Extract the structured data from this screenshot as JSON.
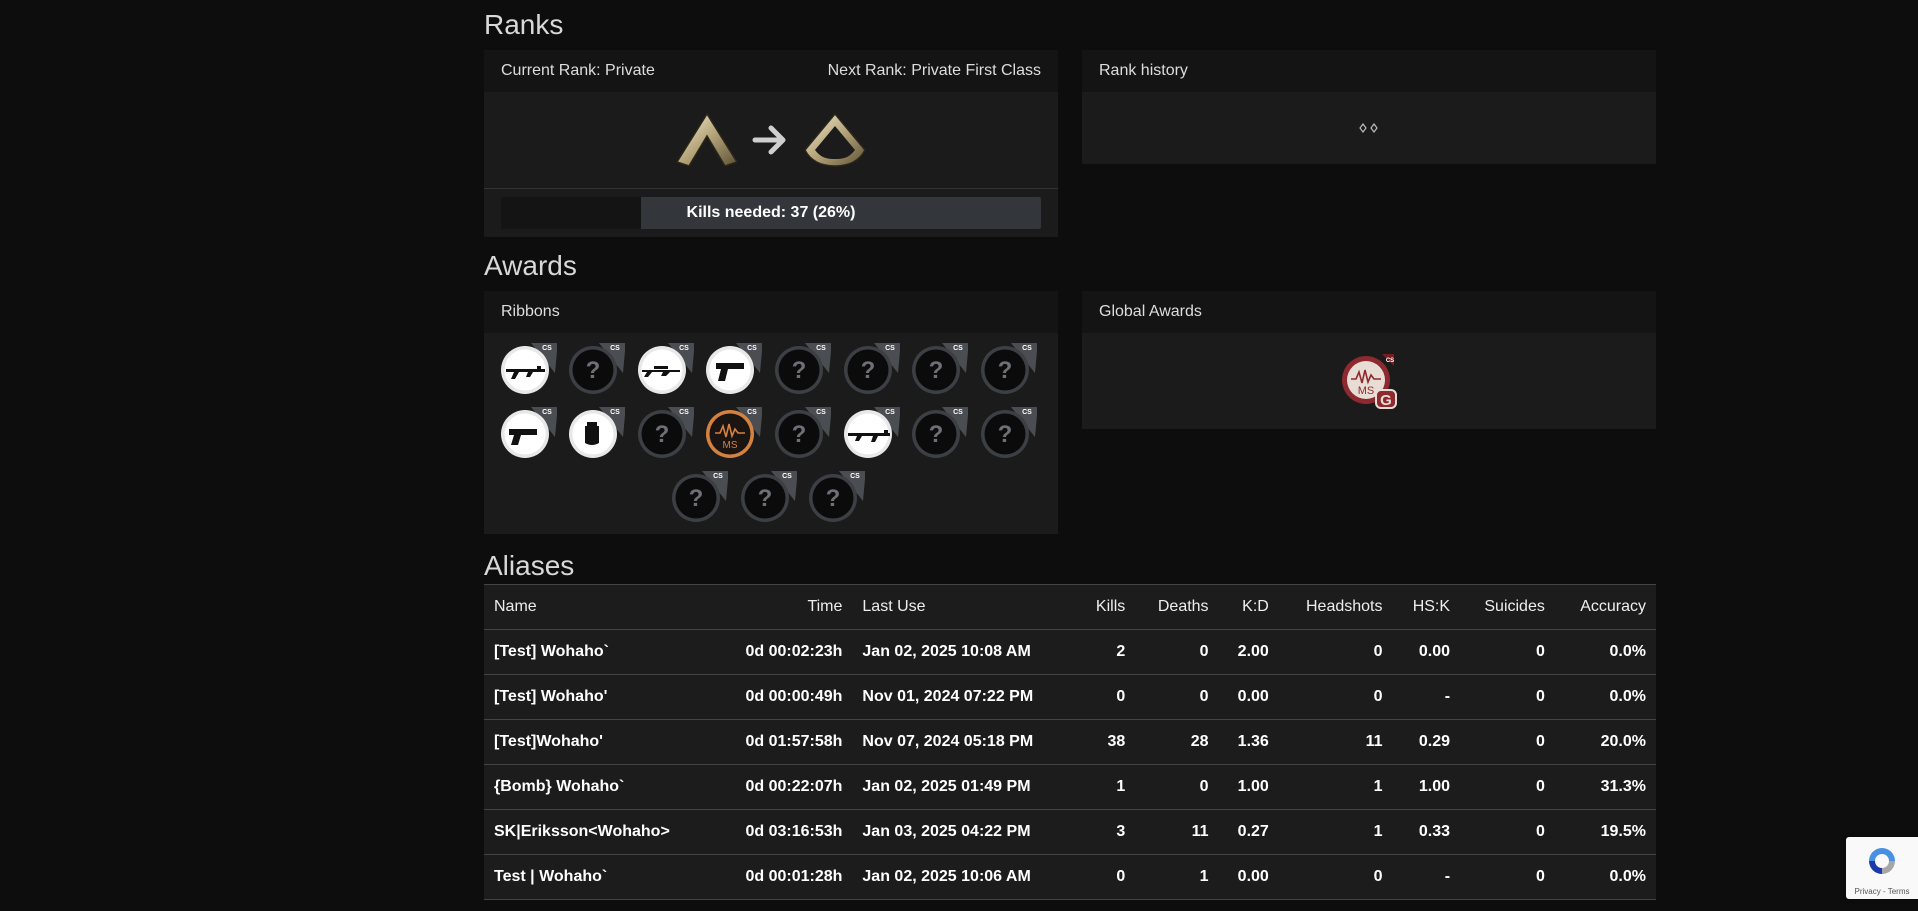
{
  "ranks": {
    "heading": "Ranks",
    "current_label": "Current Rank: Private",
    "next_label": "Next Rank: Private First Class",
    "progress_text": "Kills needed: 37 (26%)",
    "progress_fraction": 0.26,
    "history_title": "Rank history"
  },
  "awards": {
    "heading": "Awards",
    "ribbons_title": "Ribbons",
    "global_title": "Global Awards",
    "ribbons": [
      {
        "icon": "ak47-icon",
        "unlocked": true
      },
      {
        "icon": "unknown-award-icon",
        "unlocked": false
      },
      {
        "icon": "sniper-rifle-icon",
        "unlocked": true
      },
      {
        "icon": "deagle-icon",
        "unlocked": true
      },
      {
        "icon": "unknown-award-icon",
        "unlocked": false
      },
      {
        "icon": "unknown-award-icon",
        "unlocked": false
      },
      {
        "icon": "unknown-award-icon",
        "unlocked": false
      },
      {
        "icon": "unknown-award-icon",
        "unlocked": false
      },
      {
        "icon": "pistol-icon",
        "unlocked": true
      },
      {
        "icon": "grenade-icon",
        "unlocked": true
      },
      {
        "icon": "unknown-award-icon",
        "unlocked": false
      },
      {
        "icon": "medic-ms-icon",
        "unlocked": true
      },
      {
        "icon": "unknown-award-icon",
        "unlocked": false
      },
      {
        "icon": "m4-rifle-icon",
        "unlocked": true
      },
      {
        "icon": "unknown-award-icon",
        "unlocked": false
      },
      {
        "icon": "unknown-award-icon",
        "unlocked": false
      },
      {
        "icon": "unknown-award-icon",
        "unlocked": false
      },
      {
        "icon": "unknown-award-icon",
        "unlocked": false
      },
      {
        "icon": "unknown-award-icon",
        "unlocked": false
      }
    ],
    "badge_tag": "CS",
    "unknown_glyph": "?",
    "medic_text": "MS",
    "global_grade": "G"
  },
  "aliases": {
    "heading": "Aliases",
    "columns": [
      "Name",
      "Time",
      "Last Use",
      "Kills",
      "Deaths",
      "K:D",
      "Headshots",
      "HS:K",
      "Suicides",
      "Accuracy"
    ],
    "rows": [
      [
        "[Test] Wohaho`",
        "0d 00:02:23h",
        "Jan 02, 2025 10:08 AM",
        "2",
        "0",
        "2.00",
        "0",
        "0.00",
        "0",
        "0.0%"
      ],
      [
        "[Test] Wohaho'",
        "0d 00:00:49h",
        "Nov 01, 2024 07:22 PM",
        "0",
        "0",
        "0.00",
        "0",
        "-",
        "0",
        "0.0%"
      ],
      [
        "[Test]Wohaho'",
        "0d 01:57:58h",
        "Nov 07, 2024 05:18 PM",
        "38",
        "28",
        "1.36",
        "11",
        "0.29",
        "0",
        "20.0%"
      ],
      [
        "{Bomb} Wohaho`",
        "0d 00:22:07h",
        "Jan 02, 2025 01:49 PM",
        "1",
        "0",
        "1.00",
        "1",
        "1.00",
        "0",
        "31.3%"
      ],
      [
        "SK|Eriksson<Wohaho>",
        "0d 03:16:53h",
        "Jan 03, 2025 04:22 PM",
        "3",
        "11",
        "0.27",
        "1",
        "0.33",
        "0",
        "19.5%"
      ],
      [
        "Test | Wohaho`",
        "0d 00:01:28h",
        "Jan 02, 2025 10:06 AM",
        "0",
        "1",
        "0.00",
        "0",
        "-",
        "0",
        "0.0%"
      ]
    ]
  },
  "recaptcha": {
    "terms": "Privacy - Terms"
  }
}
